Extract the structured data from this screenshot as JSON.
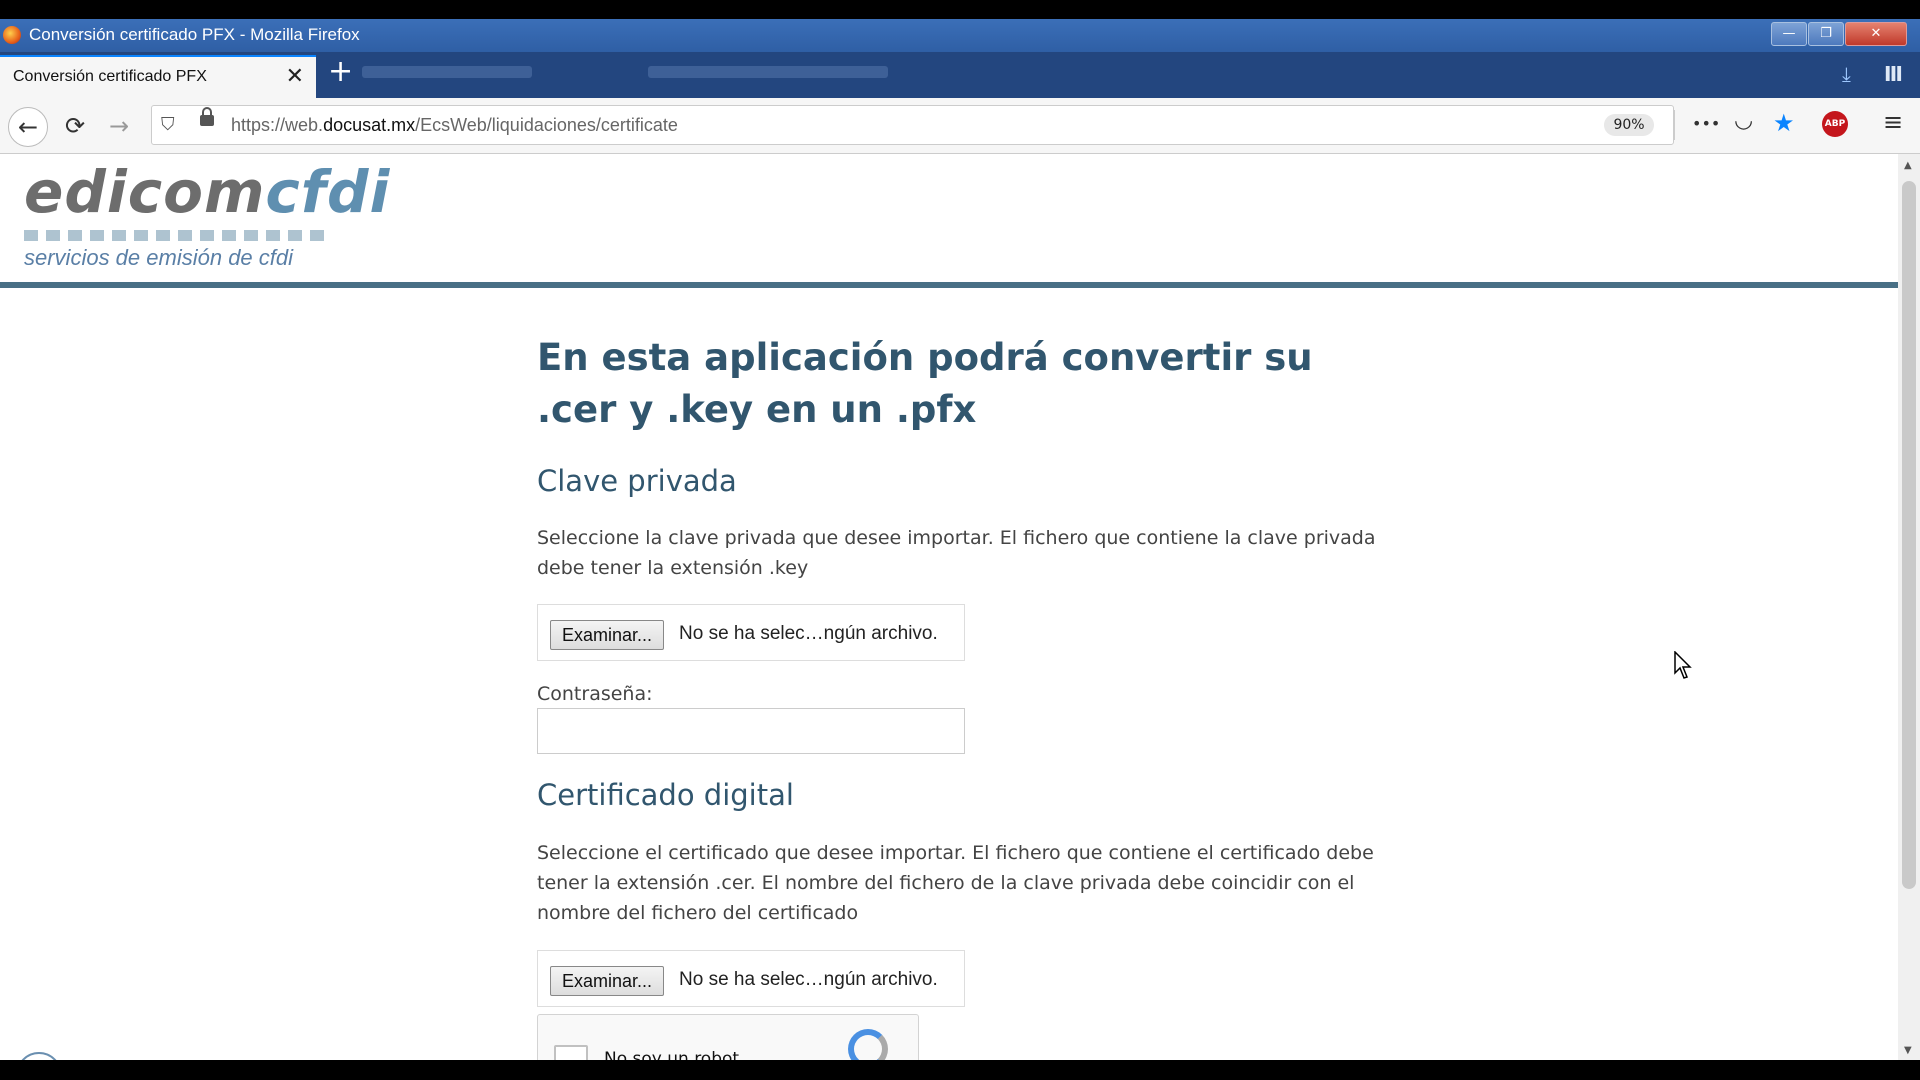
{
  "window": {
    "title": "Conversión certificado PFX - Mozilla Firefox",
    "minimize": "—",
    "restore": "❐",
    "close": "✕"
  },
  "tabs": {
    "active_title": "Conversión certificado PFX",
    "close_glyph": "✕",
    "new_tab_glyph": "+"
  },
  "nav": {
    "back_glyph": "←",
    "reload_glyph": "⟳",
    "forward_glyph": "→",
    "url_prefix": "https://web.",
    "url_domain": "docusat.mx",
    "url_path": "/EcsWeb/liquidaciones/certificate",
    "zoom": "90%",
    "more_glyph": "•••",
    "pocket_glyph": "◡",
    "star_glyph": "★",
    "abp_label": "ABP",
    "menu_glyph": "≡",
    "library_glyph": "Ⅲ",
    "download_glyph": "⤓"
  },
  "logo": {
    "brand_a": "edicom",
    "brand_b": "cfdi",
    "tagline": "servicios de emisión de cfdi"
  },
  "main": {
    "heading": "En esta aplicación podrá convertir su .cer y .key en un .pfx",
    "private_key": {
      "title": "Clave privada",
      "description": "Seleccione la clave privada que desee importar. El fichero que contiene la clave privada debe tener la extensión .key",
      "browse_label": "Examinar...",
      "file_status": "No se ha selec…ngún archivo."
    },
    "password_label": "Contraseña:",
    "certificate": {
      "title": "Certificado digital",
      "description": "Seleccione el certificado que desee importar. El fichero que contiene el certificado debe tener la extensión .cer. El nombre del fichero de la clave privada debe coincidir con el nombre del fichero del certificado",
      "browse_label": "Examinar...",
      "file_status": "No se ha selec…ngún archivo."
    },
    "captcha_label": "No soy un robot"
  },
  "colors": {
    "heading": "#31566e",
    "header_rule": "#486f85",
    "titlebar": "#2f5fa5",
    "star": "#0a84ff"
  }
}
